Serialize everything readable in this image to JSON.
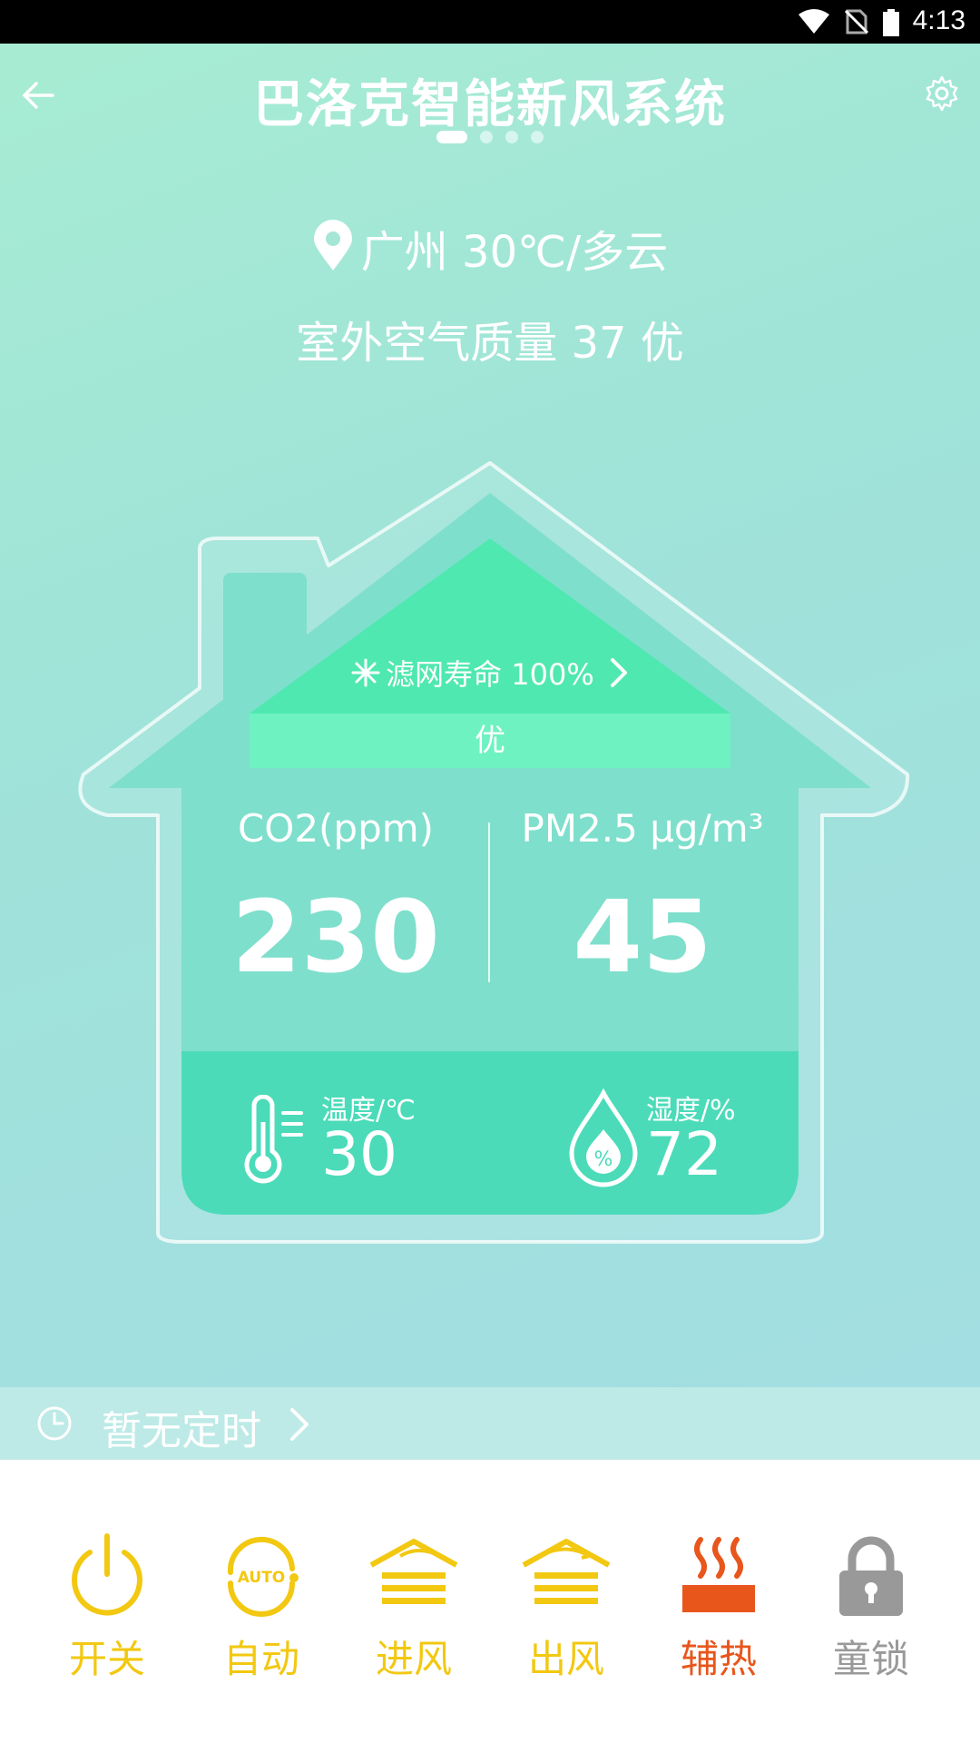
{
  "status_bar": {
    "time": "4:13"
  },
  "header": {
    "title": "巴洛克智能新风系统"
  },
  "weather": {
    "text": "广州 30℃/多云"
  },
  "air_quality": {
    "text": "室外空气质量 37 优"
  },
  "filter": {
    "text": "滤网寿命 100%"
  },
  "indoor_quality": "优",
  "metrics": {
    "co2": {
      "label": "CO2(ppm)",
      "value": "230"
    },
    "pm25": {
      "label": "PM2.5 μg/m³",
      "value": "45"
    }
  },
  "sensors": {
    "temperature": {
      "label": "温度/℃",
      "value": "30"
    },
    "humidity": {
      "label": "湿度/%",
      "value": "72"
    }
  },
  "timer": {
    "text": "暂无定时"
  },
  "controls": [
    {
      "label": "开关",
      "icon": "power-icon",
      "color": "#f2c811"
    },
    {
      "label": "自动",
      "icon": "auto-icon",
      "color": "#f2c811"
    },
    {
      "label": "进风",
      "icon": "air-in-icon",
      "color": "#f2c811"
    },
    {
      "label": "出风",
      "icon": "air-out-icon",
      "color": "#f2c811"
    },
    {
      "label": "辅热",
      "icon": "heater-icon",
      "color": "#e8561c"
    },
    {
      "label": "童锁",
      "icon": "lock-icon",
      "color": "#999999"
    }
  ],
  "colors": {
    "accent_yellow": "#f2c811",
    "heat_orange": "#e8561c",
    "lock_gray": "#999999",
    "roof_green": "#4fe8b0",
    "bottom_panel": "#4bdbb9"
  }
}
